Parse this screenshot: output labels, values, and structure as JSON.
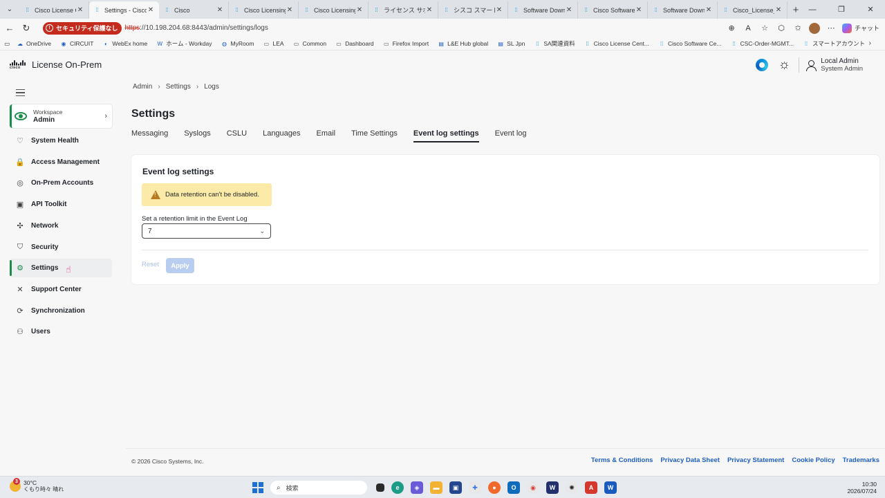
{
  "browser": {
    "tabs": [
      {
        "label": "Cisco License Cent",
        "icon": "cisco-icon",
        "active": false
      },
      {
        "label": "Settings - Cisco Li",
        "icon": "cisco-icon",
        "active": true
      },
      {
        "label": "Cisco",
        "icon": "cisco-icon",
        "active": false
      },
      {
        "label": "Cisco Licensing H",
        "icon": "cisco-icon",
        "active": false
      },
      {
        "label": "Cisco Licensing S",
        "icon": "cisco-icon",
        "active": false
      },
      {
        "label": "ライセンス サポート",
        "icon": "cisco-icon",
        "active": false
      },
      {
        "label": "シスコ スマート アカ",
        "icon": "cisco-icon",
        "active": false
      },
      {
        "label": "Software Downlo",
        "icon": "cisco-icon",
        "active": false
      },
      {
        "label": "Cisco Software Ce",
        "icon": "cisco-icon",
        "active": false
      },
      {
        "label": "Software Downlo",
        "icon": "cisco-icon",
        "active": false
      },
      {
        "label": "Cisco_License_On",
        "icon": "cisco-icon",
        "active": false
      }
    ],
    "security_badge": "セキュリティ保護なし",
    "url_scheme": "https",
    "url_rest": "://10.198.204.68:8443/admin/settings/logs",
    "copilot_label": "チャット",
    "bookmarks": [
      {
        "label": "OneDrive",
        "icon": "cloud-icon"
      },
      {
        "label": "CIRCUIT",
        "icon": "circuit-icon"
      },
      {
        "label": "WebEx home",
        "icon": "webex-icon"
      },
      {
        "label": "ホーム - Workday",
        "icon": "workday-icon"
      },
      {
        "label": "MyRoom",
        "icon": "globe-icon"
      },
      {
        "label": "LEA",
        "icon": "folder-icon"
      },
      {
        "label": "Common",
        "icon": "folder-icon"
      },
      {
        "label": "Dashboard",
        "icon": "folder-icon"
      },
      {
        "label": "Firefox Import",
        "icon": "folder-icon"
      },
      {
        "label": "L&E Hub global",
        "icon": "page-icon"
      },
      {
        "label": "SL Jpn",
        "icon": "page-icon"
      },
      {
        "label": "SA関連資料",
        "icon": "cisco-icon"
      },
      {
        "label": "Cisco License Cent...",
        "icon": "cisco-icon"
      },
      {
        "label": "Cisco Software Ce...",
        "icon": "cisco-icon"
      },
      {
        "label": "CSC-Order-MGMT...",
        "icon": "cisco-icon"
      },
      {
        "label": "スマートアカウント",
        "icon": "cisco-icon"
      }
    ]
  },
  "header": {
    "logo_text": "cisco",
    "app_title": "License On-Prem",
    "user_name": "Local Admin",
    "user_role": "System Admin"
  },
  "sidebar": {
    "workspace_label": "Workspace",
    "workspace_value": "Admin",
    "items": [
      {
        "label": "System Health",
        "icon": "health-icon",
        "active": false
      },
      {
        "label": "Access Management",
        "icon": "lock-icon",
        "active": false
      },
      {
        "label": "On-Prem Accounts",
        "icon": "accounts-icon",
        "active": false
      },
      {
        "label": "API Toolkit",
        "icon": "api-icon",
        "active": false
      },
      {
        "label": "Network",
        "icon": "network-icon",
        "active": false
      },
      {
        "label": "Security",
        "icon": "shield-icon",
        "active": false
      },
      {
        "label": "Settings",
        "icon": "gear-icon",
        "active": true
      },
      {
        "label": "Support Center",
        "icon": "tools-icon",
        "active": false
      },
      {
        "label": "Synchronization",
        "icon": "sync-icon",
        "active": false
      },
      {
        "label": "Users",
        "icon": "users-icon",
        "active": false
      }
    ]
  },
  "main": {
    "breadcrumb": [
      "Admin",
      "Settings",
      "Logs"
    ],
    "title": "Settings",
    "tabs": [
      {
        "label": "Messaging",
        "active": false
      },
      {
        "label": "Syslogs",
        "active": false
      },
      {
        "label": "CSLU",
        "active": false
      },
      {
        "label": "Languages",
        "active": false
      },
      {
        "label": "Email",
        "active": false
      },
      {
        "label": "Time Settings",
        "active": false
      },
      {
        "label": "Event log settings",
        "active": true
      },
      {
        "label": "Event log",
        "active": false
      }
    ],
    "card": {
      "title": "Event log settings",
      "alert": "Data retention can't be disabled.",
      "field_label": "Set a retention limit in the Event Log",
      "field_value": "7",
      "reset_label": "Reset",
      "apply_label": "Apply"
    }
  },
  "footer": {
    "copyright": "© 2026 Cisco Systems, Inc.",
    "links": [
      "Terms & Conditions",
      "Privacy Data Sheet",
      "Privacy Statement",
      "Cookie Policy",
      "Trademarks"
    ]
  },
  "taskbar": {
    "temperature": "30°C",
    "weather": "くもり時々 晴れ",
    "weather_badge": "3",
    "search_placeholder": "検索",
    "time": "10:30",
    "date": "2026/07/24"
  },
  "colors": {
    "accent_green": "#1c8c4a",
    "link_blue": "#1f5fbf",
    "alert_bg": "#fbeaa8",
    "security_red": "#c42b1c"
  }
}
